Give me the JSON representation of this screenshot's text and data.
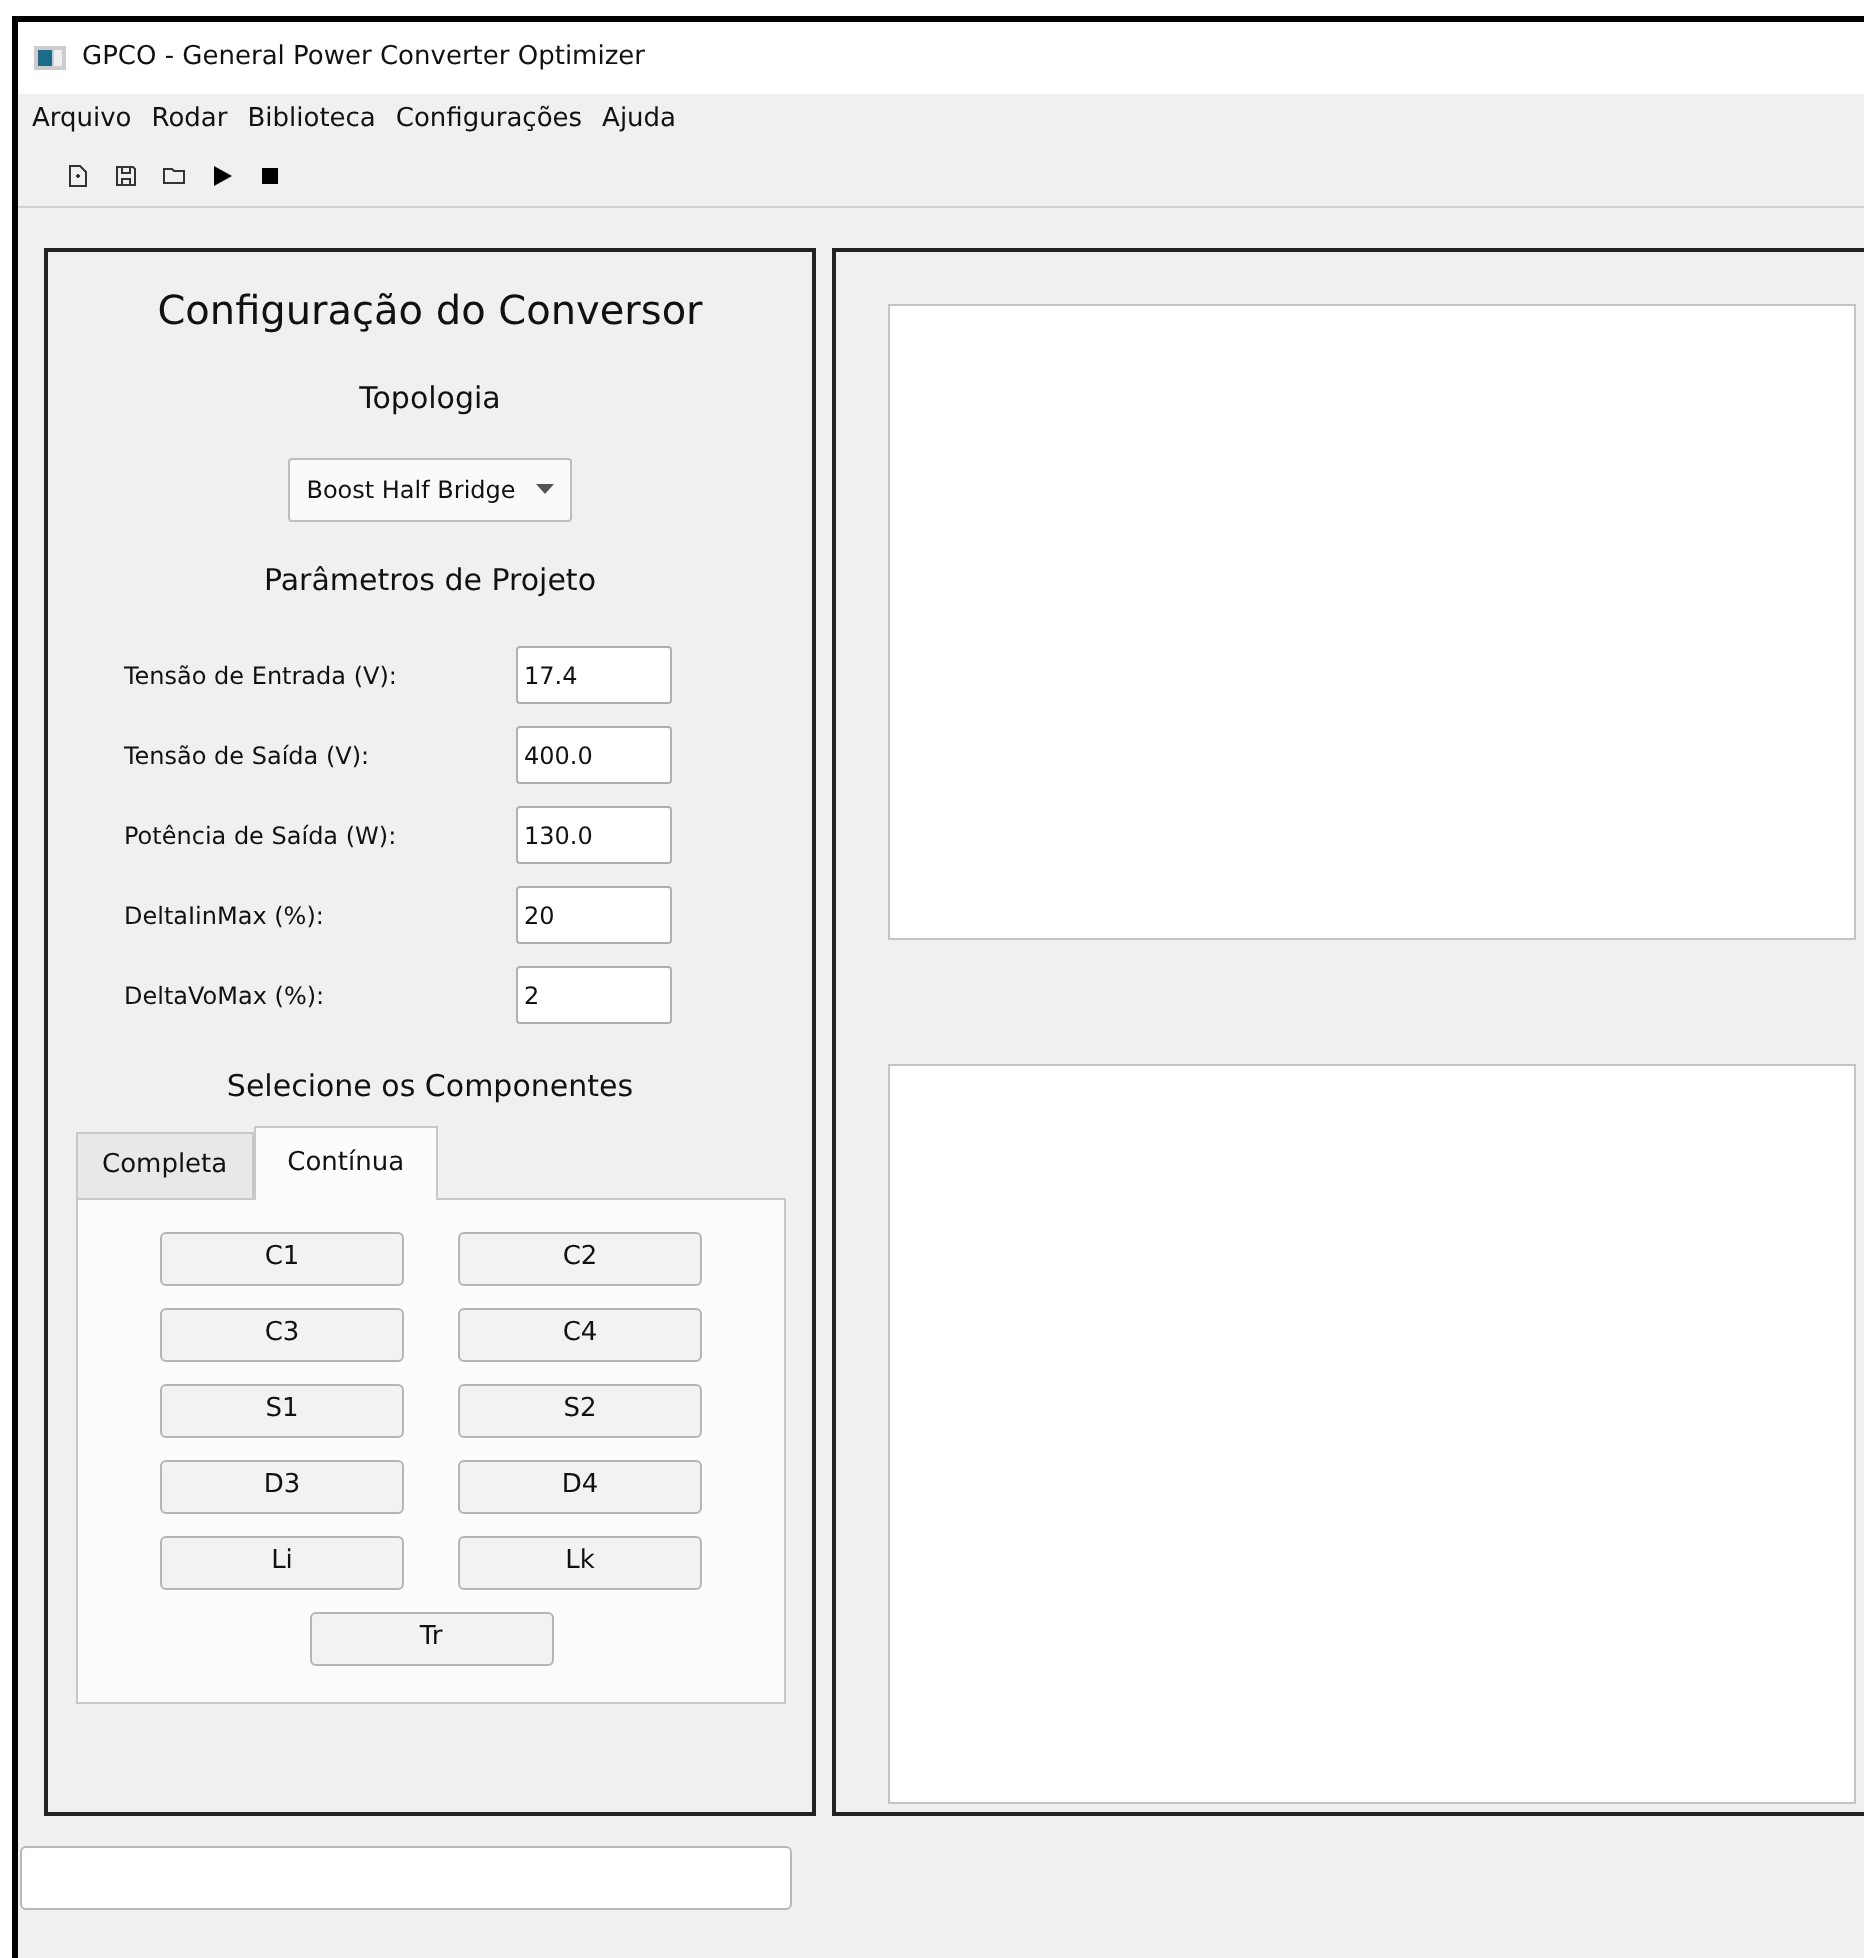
{
  "window": {
    "title": "GPCO - General Power Converter Optimizer"
  },
  "menu": [
    "Arquivo",
    "Rodar",
    "Biblioteca",
    "Configurações",
    "Ajuda"
  ],
  "toolbar": [
    {
      "kind": "new"
    },
    {
      "kind": "save"
    },
    {
      "kind": "open"
    },
    {
      "kind": "run"
    },
    {
      "kind": "stop"
    }
  ],
  "config": {
    "title": "Configuração do Conversor",
    "topology_label": "Topologia",
    "topology": "Boost Half Bridge",
    "params_title": "Parâmetros de Projeto",
    "params": [
      {
        "label": "Tensão de Entrada (V):",
        "value": "17.4"
      },
      {
        "label": "Tensão de Saída (V):",
        "value": "400.0"
      },
      {
        "label": "Potência de Saída (W):",
        "value": "130.0"
      },
      {
        "label": "DeltaIinMax (%):",
        "value": "20"
      },
      {
        "label": "DeltaVoMax (%):",
        "value": "2"
      }
    ],
    "components_title": "Selecione os Componentes",
    "tabs": [
      {
        "label": "Completa",
        "selected": false
      },
      {
        "label": "Contínua",
        "selected": true
      }
    ],
    "buttons": [
      "C1",
      "C2",
      "C3",
      "C4",
      "S1",
      "S2",
      "D3",
      "D4",
      "Li",
      "Lk",
      "Tr"
    ]
  }
}
